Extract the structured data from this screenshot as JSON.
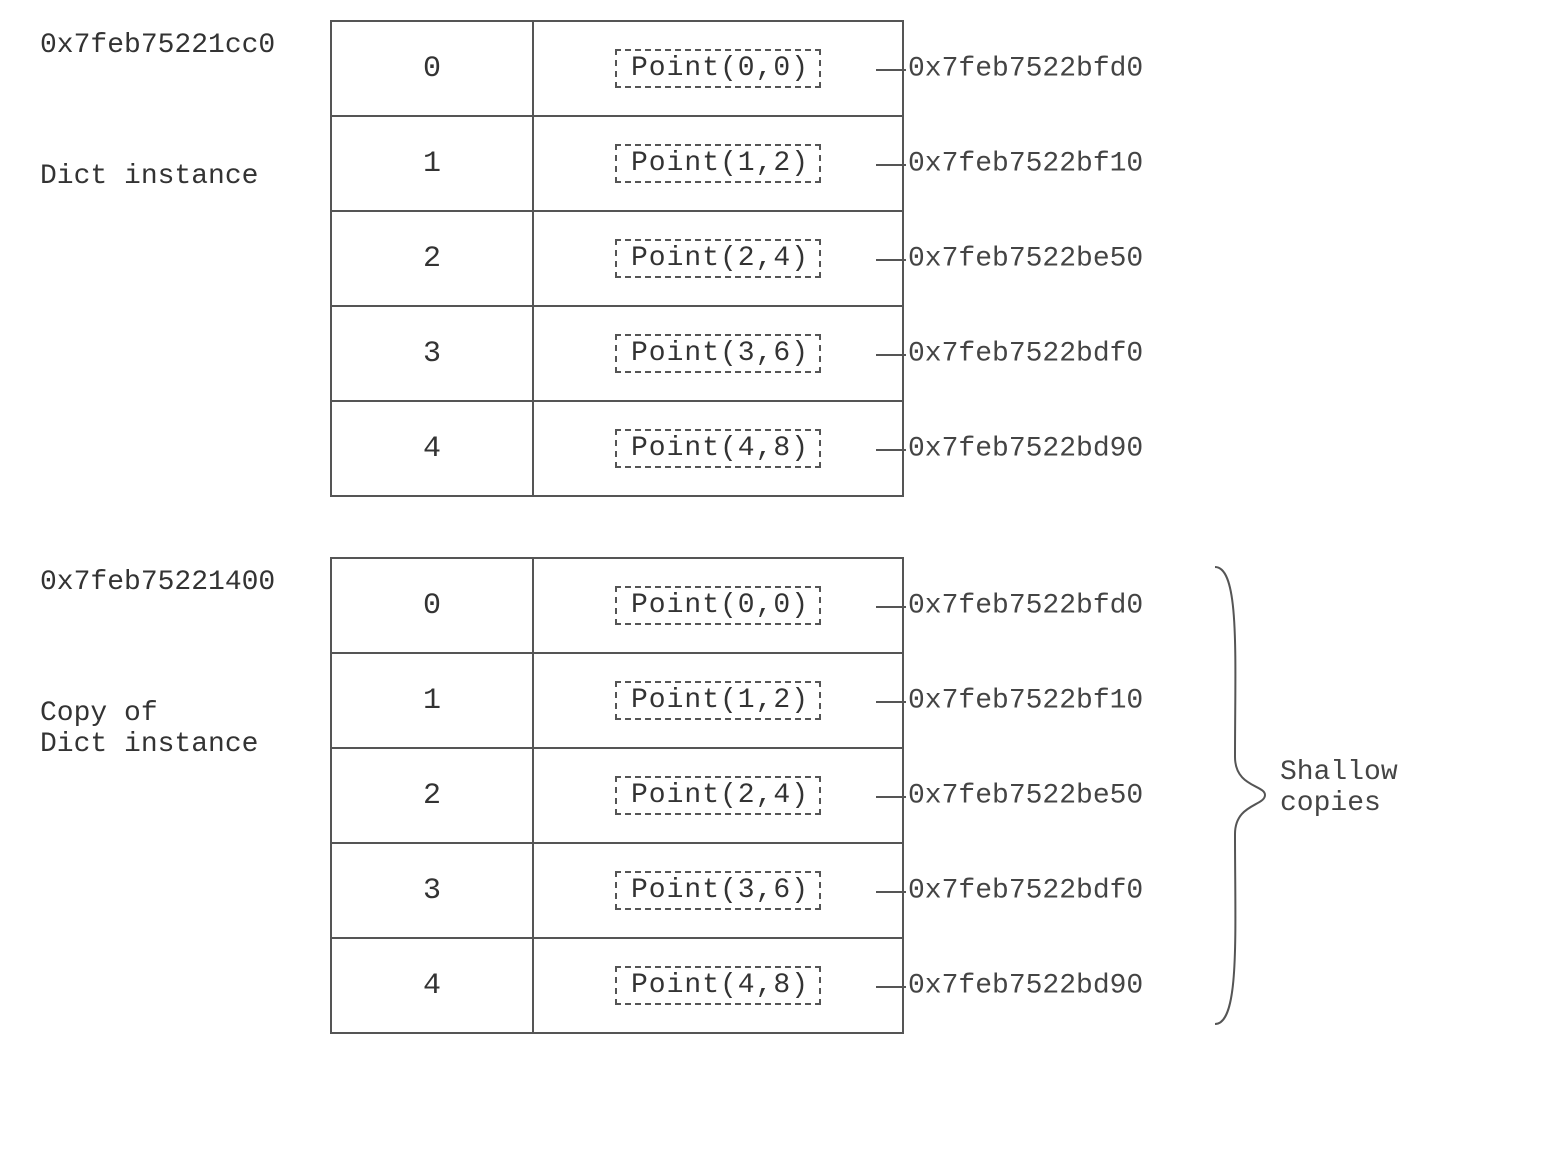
{
  "sections": [
    {
      "dict_address": "0x7feb75221cc0",
      "caption": "Dict instance",
      "rows": [
        {
          "key": "0",
          "value": "Point(0,0)",
          "value_address": "0x7feb7522bfd0"
        },
        {
          "key": "1",
          "value": "Point(1,2)",
          "value_address": "0x7feb7522bf10"
        },
        {
          "key": "2",
          "value": "Point(2,4)",
          "value_address": "0x7feb7522be50"
        },
        {
          "key": "3",
          "value": "Point(3,6)",
          "value_address": "0x7feb7522bdf0"
        },
        {
          "key": "4",
          "value": "Point(4,8)",
          "value_address": "0x7feb7522bd90"
        }
      ]
    },
    {
      "dict_address": "0x7feb75221400",
      "caption": "Copy of\nDict instance",
      "rows": [
        {
          "key": "0",
          "value": "Point(0,0)",
          "value_address": "0x7feb7522bfd0"
        },
        {
          "key": "1",
          "value": "Point(1,2)",
          "value_address": "0x7feb7522bf10"
        },
        {
          "key": "2",
          "value": "Point(2,4)",
          "value_address": "0x7feb7522be50"
        },
        {
          "key": "3",
          "value": "Point(3,6)",
          "value_address": "0x7feb7522bdf0"
        },
        {
          "key": "4",
          "value": "Point(4,8)",
          "value_address": "0x7feb7522bd90"
        }
      ]
    }
  ],
  "shallow_label": "Shallow\ncopies"
}
